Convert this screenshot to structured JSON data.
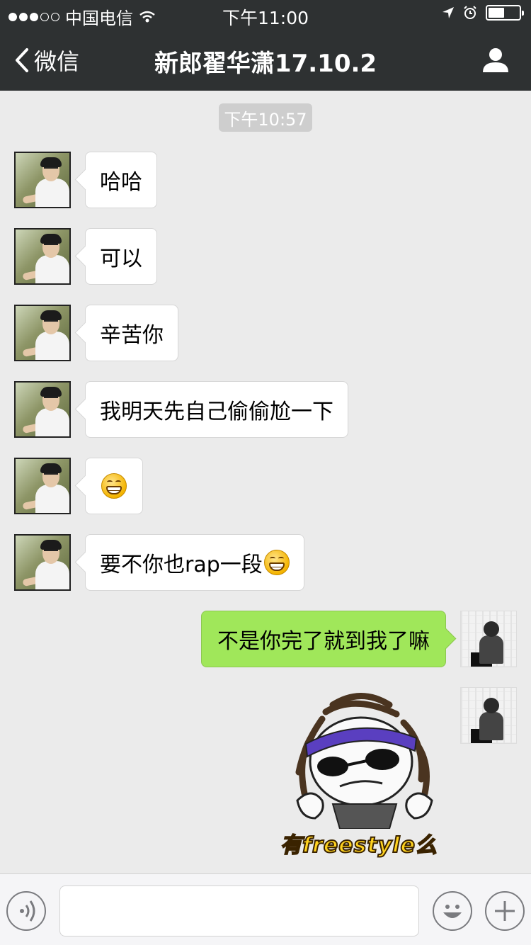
{
  "status_bar": {
    "carrier": "中国电信",
    "time": "下午11:00"
  },
  "nav": {
    "back_label": "微信",
    "title": "新郎翟华潇17.10.2"
  },
  "chat": {
    "timestamp": "下午10:57",
    "incoming": [
      {
        "text": "哈哈",
        "emoji": false
      },
      {
        "text": "可以",
        "emoji": false
      },
      {
        "text": "辛苦你",
        "emoji": false
      },
      {
        "text": "我明天先自己偷偷尬一下",
        "emoji": false
      },
      {
        "text": "",
        "emoji": true
      },
      {
        "text": "要不你也rap一段",
        "emoji": true
      }
    ],
    "outgoing_text": "不是你完了就到我了嘛",
    "sticker_caption": "有freestyle么"
  },
  "icons": {
    "back": "chevron-left-icon",
    "contact": "person-icon",
    "voice": "voice-icon",
    "emoji": "emoji-icon",
    "add": "plus-icon"
  },
  "colors": {
    "bar": "#2e3132",
    "background": "#ebebeb",
    "outgoing_bubble": "#a0e75a"
  }
}
